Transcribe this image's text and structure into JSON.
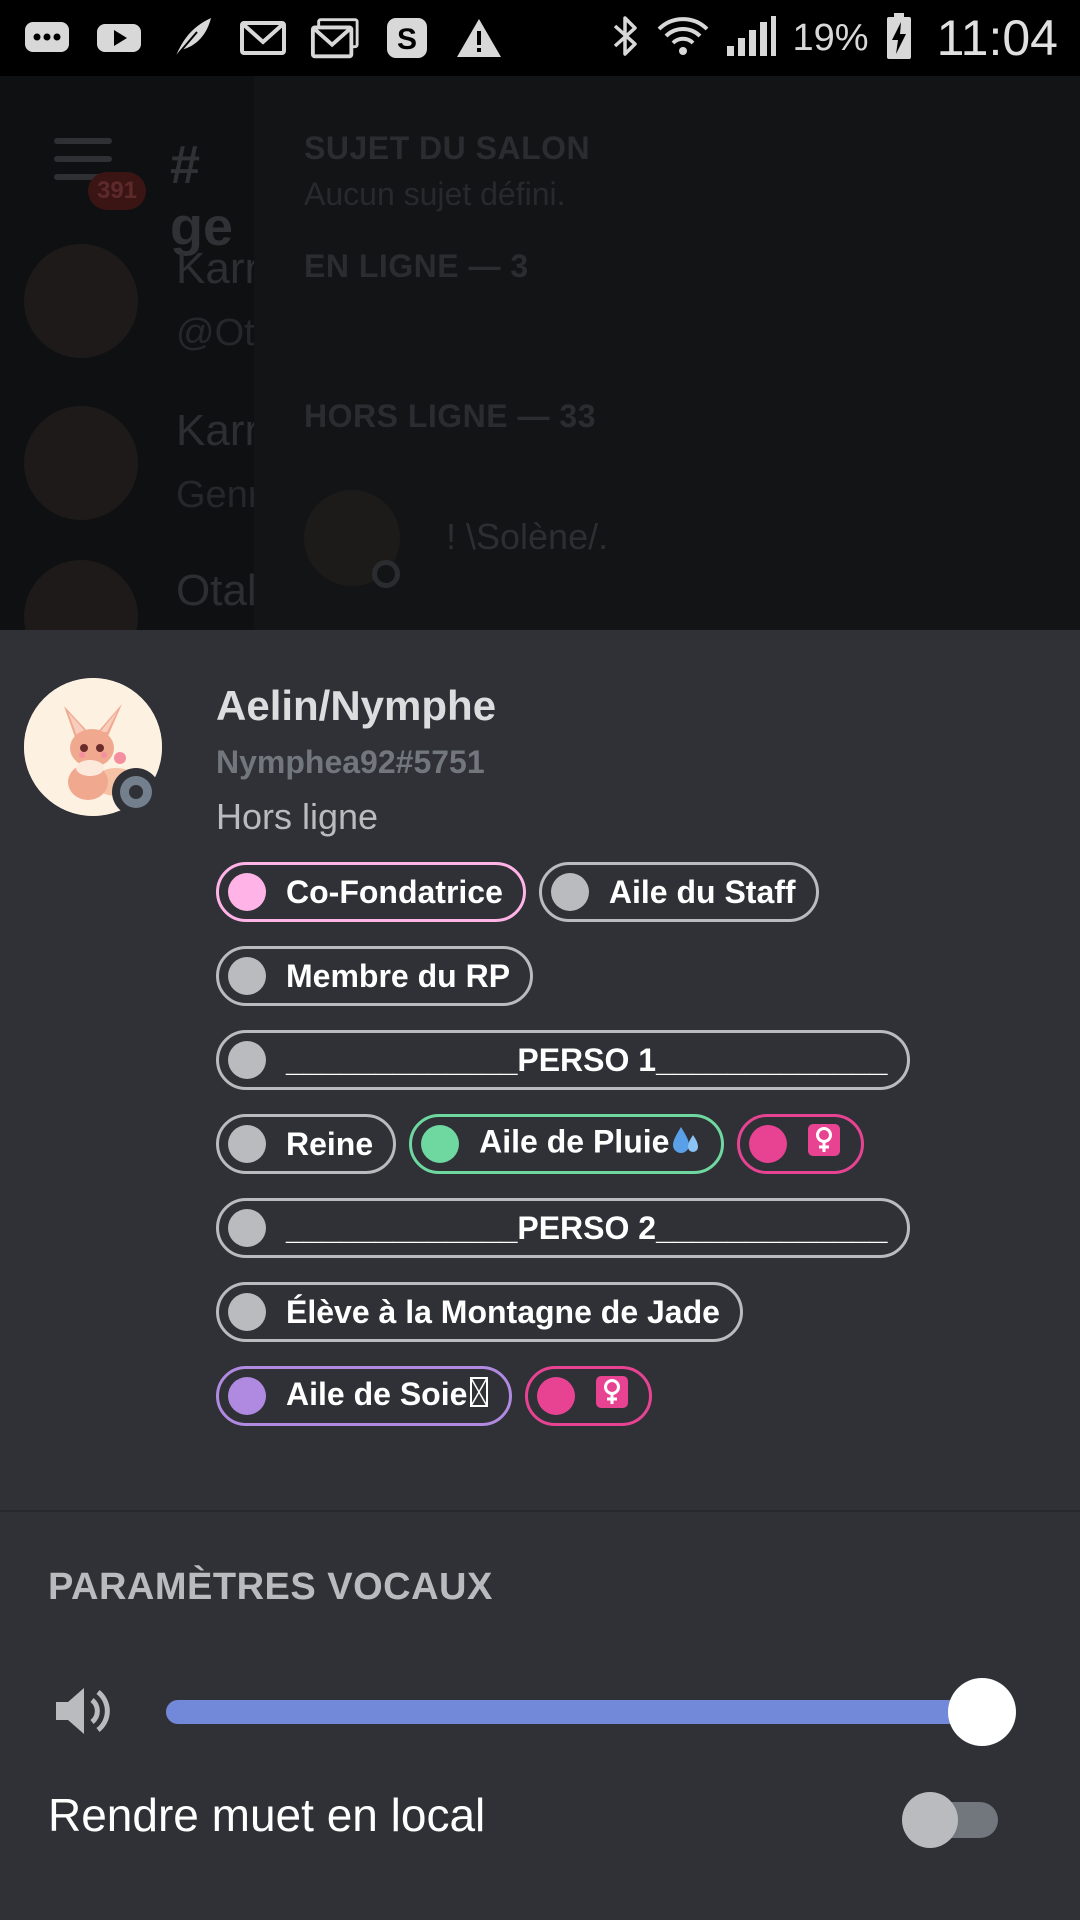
{
  "status_bar": {
    "icons": [
      "messages-icon",
      "youtube-icon",
      "feather-icon",
      "gmail-icon",
      "gmail-stack-icon",
      "skype-icon",
      "warning-icon"
    ],
    "battery_percent": "19%",
    "time": "11:04"
  },
  "background": {
    "badge_count": "391",
    "channel_prefix": "# ge",
    "messages": [
      {
        "name": "Karr",
        "sub": "@Ot"
      },
      {
        "name": "Karr",
        "sub": "Genr"
      },
      {
        "name": "Otal",
        "sub": ""
      }
    ],
    "topic_header": "SUJET DU SALON",
    "topic_value": "Aucun sujet défini.",
    "online_header": "EN LIGNE — 3",
    "offline_header": "HORS LIGNE — 33",
    "offline_user": "!    \\Solène/."
  },
  "profile": {
    "display_name": "Aelin/Nymphe",
    "tag": "Nymphea92#5751",
    "status": "Hors ligne",
    "roles": [
      {
        "label": "Co-Fondatrice",
        "color": "#ffb3e6",
        "border": "#ffb3e6",
        "emoji": ""
      },
      {
        "label": "Aile du Staff",
        "color": "#b9bbbe",
        "border": "#b9bbbe",
        "emoji": ""
      },
      {
        "label": "Membre du RP",
        "color": "#b9bbbe",
        "border": "#b9bbbe",
        "emoji": ""
      },
      {
        "label": "_____________PERSO 1_____________",
        "color": "#b9bbbe",
        "border": "#b9bbbe",
        "emoji": ""
      },
      {
        "label": "Reine",
        "color": "#b9bbbe",
        "border": "#b9bbbe",
        "emoji": ""
      },
      {
        "label": "Aile de Pluie",
        "color": "#6fd8a0",
        "border": "#6fd8a0",
        "emoji": "droplets-icon"
      },
      {
        "label": "",
        "color": "#e84393",
        "border": "#e84393",
        "emoji": "female-sign-icon"
      },
      {
        "label": "_____________PERSO 2_____________",
        "color": "#b9bbbe",
        "border": "#b9bbbe",
        "emoji": ""
      },
      {
        "label": "Élève à la Montagne de Jade",
        "color": "#b9bbbe",
        "border": "#b9bbbe",
        "emoji": ""
      },
      {
        "label": "Aile de Soie",
        "color": "#b089e0",
        "border": "#b089e0",
        "emoji": "missing-glyph-icon"
      },
      {
        "label": "",
        "color": "#e84393",
        "border": "#e84393",
        "emoji": "female-sign-icon"
      }
    ]
  },
  "voice_settings": {
    "title": "PARAMÈTRES VOCAUX",
    "volume_fraction": 1.0,
    "mute_label": "Rendre muet en local",
    "mute_enabled": false
  }
}
